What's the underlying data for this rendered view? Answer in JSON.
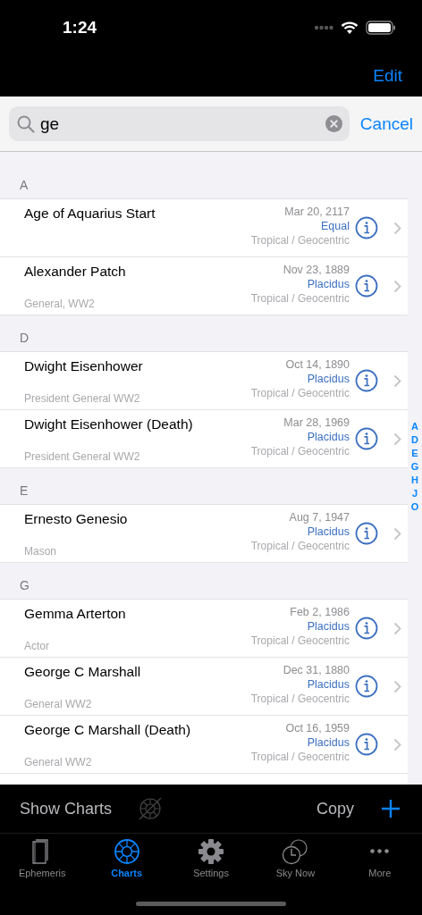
{
  "status_bar": {
    "time": "1:24"
  },
  "nav": {
    "edit": "Edit"
  },
  "search": {
    "value": "ge",
    "cancel": "Cancel"
  },
  "sections": [
    {
      "letter": "A",
      "rows": [
        {
          "name": "Age of Aquarius Start",
          "date": "Mar 20, 2117",
          "house_system": "Equal",
          "zodiac": "Tropical / Geocentric"
        },
        {
          "name": "Alexander Patch",
          "subtitle": "General, WW2",
          "date": "Nov 23, 1889",
          "house_system": "Placidus",
          "zodiac": "Tropical / Geocentric"
        }
      ]
    },
    {
      "letter": "D",
      "rows": [
        {
          "name": "Dwight Eisenhower",
          "subtitle": "President General WW2",
          "date": "Oct 14, 1890",
          "house_system": "Placidus",
          "zodiac": "Tropical / Geocentric"
        },
        {
          "name": "Dwight Eisenhower (Death)",
          "subtitle": "President General WW2",
          "date": "Mar 28, 1969",
          "house_system": "Placidus",
          "zodiac": "Tropical / Geocentric"
        }
      ]
    },
    {
      "letter": "E",
      "rows": [
        {
          "name": "Ernesto Genesio",
          "subtitle": "Mason",
          "date": "Aug 7, 1947",
          "house_system": "Placidus",
          "zodiac": "Tropical / Geocentric"
        }
      ]
    },
    {
      "letter": "G",
      "rows": [
        {
          "name": "Gemma Arterton",
          "subtitle": "Actor",
          "date": "Feb 2, 1986",
          "house_system": "Placidus",
          "zodiac": "Tropical / Geocentric"
        },
        {
          "name": "George C Marshall",
          "subtitle": "General WW2",
          "date": "Dec 31, 1880",
          "house_system": "Placidus",
          "zodiac": "Tropical / Geocentric"
        },
        {
          "name": "George C Marshall (Death)",
          "subtitle": "General WW2",
          "date": "Oct 16, 1959",
          "house_system": "Placidus",
          "zodiac": "Tropical / Geocentric"
        },
        {
          "partial": true
        }
      ]
    }
  ],
  "index": [
    "A",
    "D",
    "E",
    "G",
    "H",
    "J",
    "O"
  ],
  "toolbar": {
    "show_charts": "Show Charts",
    "copy": "Copy"
  },
  "tabs": [
    {
      "label": "Ephemeris",
      "kind": "book",
      "selected": false
    },
    {
      "label": "Charts",
      "kind": "wheel",
      "selected": true
    },
    {
      "label": "Settings",
      "kind": "gear",
      "selected": false
    },
    {
      "label": "Sky Now",
      "kind": "clock",
      "selected": false
    },
    {
      "label": "More",
      "kind": "dots",
      "selected": false
    }
  ]
}
